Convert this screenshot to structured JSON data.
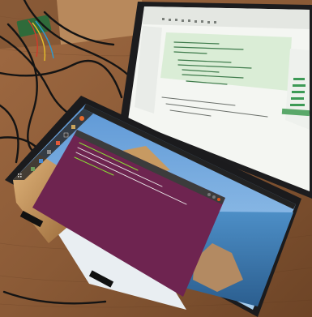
{
  "scene": {
    "description_color_palette": {
      "table_wood": "#8a5a36",
      "table_wood_dark": "#5e3a20",
      "bezel": "#1c1c1e",
      "screen_white": "#f4f6f2",
      "ide_green_panel": "#cfe6cf",
      "ubuntu_terminal": "#6e2450",
      "ubuntu_topbar": "#222222",
      "sky_blue": "#7fb4e6",
      "cliff_orange": "#c89a5e",
      "sea_blue": "#3f7fb8"
    }
  },
  "top_monitor": {
    "window_title": "",
    "code_lines": [
      "",
      "",
      "",
      "",
      ""
    ]
  },
  "bottom_monitor": {
    "desktop_title": "",
    "terminal_lines": [
      "",
      "",
      ""
    ]
  }
}
